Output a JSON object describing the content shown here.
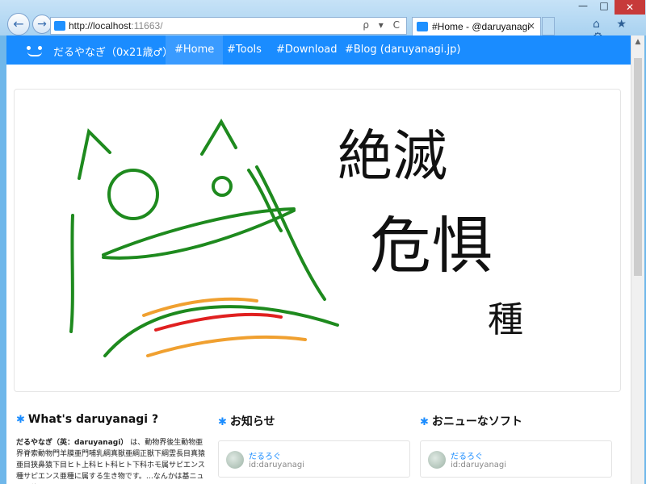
{
  "browser": {
    "url_host": "http://localhost",
    "url_port": ":11663/",
    "tab_title": "#Home - @daruyanagi",
    "close_tab": "×",
    "back": "←",
    "forward": "→",
    "address_tools": "ρ ▾ C",
    "minimize": "—",
    "maximize": "□",
    "close": "✕",
    "right_icons": "⌂ ★ ⚙"
  },
  "site": {
    "brand": "だるやなぎ（0x21歳♂）",
    "nav": [
      "#Home",
      "#Tools",
      "#Download",
      "#Blog (daruyanagi.jp)"
    ],
    "active_nav": "#Home"
  },
  "hero": {
    "text_line1": "絶滅",
    "text_line2": "危惧",
    "text_line3": "種",
    "colors": {
      "creature": "#1e8a1e",
      "stripe_orange": "#f0a030",
      "stripe_red": "#e02020"
    }
  },
  "columns": [
    {
      "title": "What's daruyanagi ?",
      "body_bold": "だるやなぎ（英：daruyanagi）",
      "body": "は、動物界後生動物亜界脊索動物門羊膜亜門哺乳綱真獣亜綱正獣下綱霊長目真猿亜目狭鼻猿下目ヒト上科ヒト科ヒト下科ホモ属サピエンス種サピエンス亜種に属する生き物です。…なんかは基ニュースサイトの"
    },
    {
      "title": "お知らせ",
      "card_name": "だるろぐ",
      "card_id": "id:daruyanagi"
    },
    {
      "title": "おニューなソフト",
      "card_name": "だるろぐ",
      "card_id": "id:daruyanagi"
    }
  ],
  "accent_color": "#1a8cff"
}
